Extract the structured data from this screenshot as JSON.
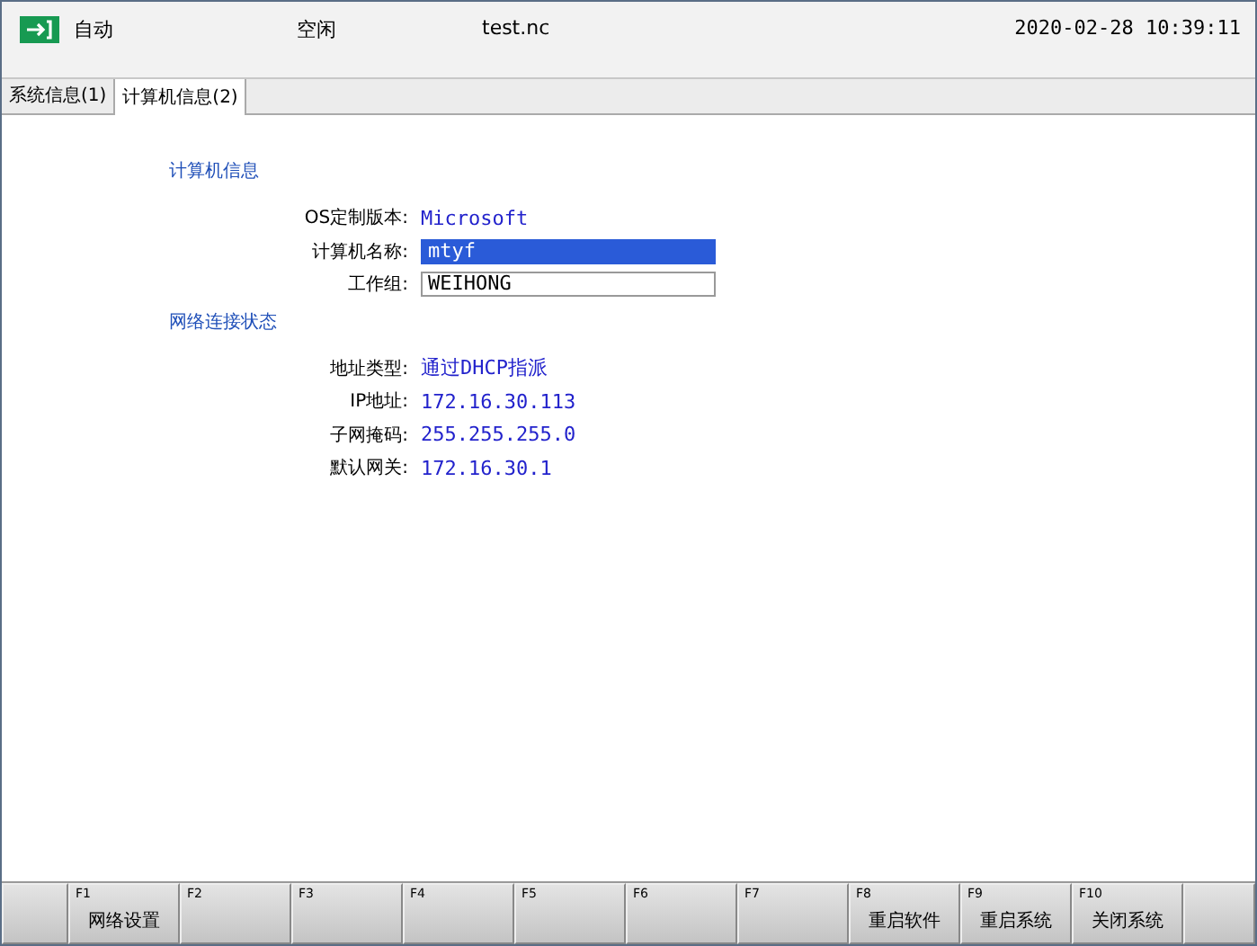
{
  "header": {
    "mode": "自动",
    "state": "空闲",
    "file": "test.nc",
    "datetime": "2020-02-28 10:39:11"
  },
  "tabs": [
    {
      "label": "系统信息(1)",
      "selected": false
    },
    {
      "label": "计算机信息(2)",
      "selected": true
    }
  ],
  "sections": [
    {
      "title": "计算机信息",
      "rows": [
        {
          "label": "OS定制版本:",
          "kind": "text",
          "value": "Microsoft"
        },
        {
          "label": "计算机名称:",
          "kind": "field",
          "value": "mtyf",
          "selected": true
        },
        {
          "label": "工作组:",
          "kind": "field",
          "value": "WEIHONG",
          "selected": false
        }
      ]
    },
    {
      "title": "网络连接状态",
      "rows": [
        {
          "label": "地址类型:",
          "kind": "text",
          "value": "通过DHCP指派"
        },
        {
          "label": "IP地址:",
          "kind": "text",
          "value": "172.16.30.113"
        },
        {
          "label": "子网掩码:",
          "kind": "text",
          "value": "255.255.255.0"
        },
        {
          "label": "默认网关:",
          "kind": "text",
          "value": "172.16.30.1"
        }
      ]
    }
  ],
  "function_keys": [
    {
      "key": "F1",
      "label": "网络设置"
    },
    {
      "key": "F2"
    },
    {
      "key": "F3"
    },
    {
      "key": "F4"
    },
    {
      "key": "F5"
    },
    {
      "key": "F6"
    },
    {
      "key": "F7"
    },
    {
      "key": "F8",
      "label": "重启软件"
    },
    {
      "key": "F9",
      "label": "重启系统"
    },
    {
      "key": "F10",
      "label": "关闭系统"
    }
  ]
}
